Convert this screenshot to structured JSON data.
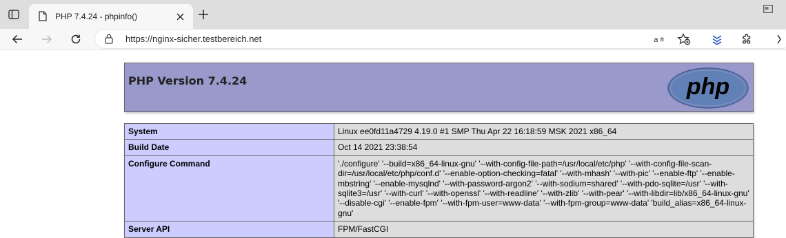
{
  "browser": {
    "tab": {
      "title": "PHP 7.4.24 - phpinfo()"
    },
    "address": {
      "url": "https://nginx-sicher.testbereich.net"
    },
    "icons": {
      "tab_actions": "tab-actions-icon",
      "favicon": "page-icon",
      "tab_close": "close-icon",
      "new_tab": "plus-icon",
      "window_control": "window-icon",
      "back": "back-arrow-icon",
      "forward": "forward-arrow-icon",
      "refresh": "refresh-icon",
      "lock": "lock-icon",
      "read_aloud": "read-aloud-icon",
      "favorite": "add-favorite-icon",
      "collections": "collections-icon",
      "extensions": "extensions-icon"
    }
  },
  "phpinfo": {
    "header": {
      "title": "PHP Version 7.4.24",
      "logo_text": "php"
    },
    "rows": [
      {
        "label": "System",
        "value": "Linux ee0fd11a4729 4.19.0 #1 SMP Thu Apr 22 16:18:59 MSK 2021 x86_64"
      },
      {
        "label": "Build Date",
        "value": "Oct 14 2021 23:38:54"
      },
      {
        "label": "Configure Command",
        "value": "'./configure' '--build=x86_64-linux-gnu' '--with-config-file-path=/usr/local/etc/php' '--with-config-file-scan-dir=/usr/local/etc/php/conf.d' '--enable-option-checking=fatal' '--with-mhash' '--with-pic' '--enable-ftp' '--enable-mbstring' '--enable-mysqlnd' '--with-password-argon2' '--with-sodium=shared' '--with-pdo-sqlite=/usr' '--with-sqlite3=/usr' '--with-curl' '--with-openssl' '--with-readline' '--with-zlib' '--with-pear' '--with-libdir=lib/x86_64-linux-gnu' '--disable-cgi' '--enable-fpm' '--with-fpm-user=www-data' '--with-fpm-group=www-data' 'build_alias=x86_64-linux-gnu'"
      },
      {
        "label": "Server API",
        "value": "FPM/FastCGI"
      }
    ],
    "colors": {
      "header_bg": "#9999cc",
      "label_bg": "#ccccff",
      "value_bg": "#dddddd"
    }
  }
}
